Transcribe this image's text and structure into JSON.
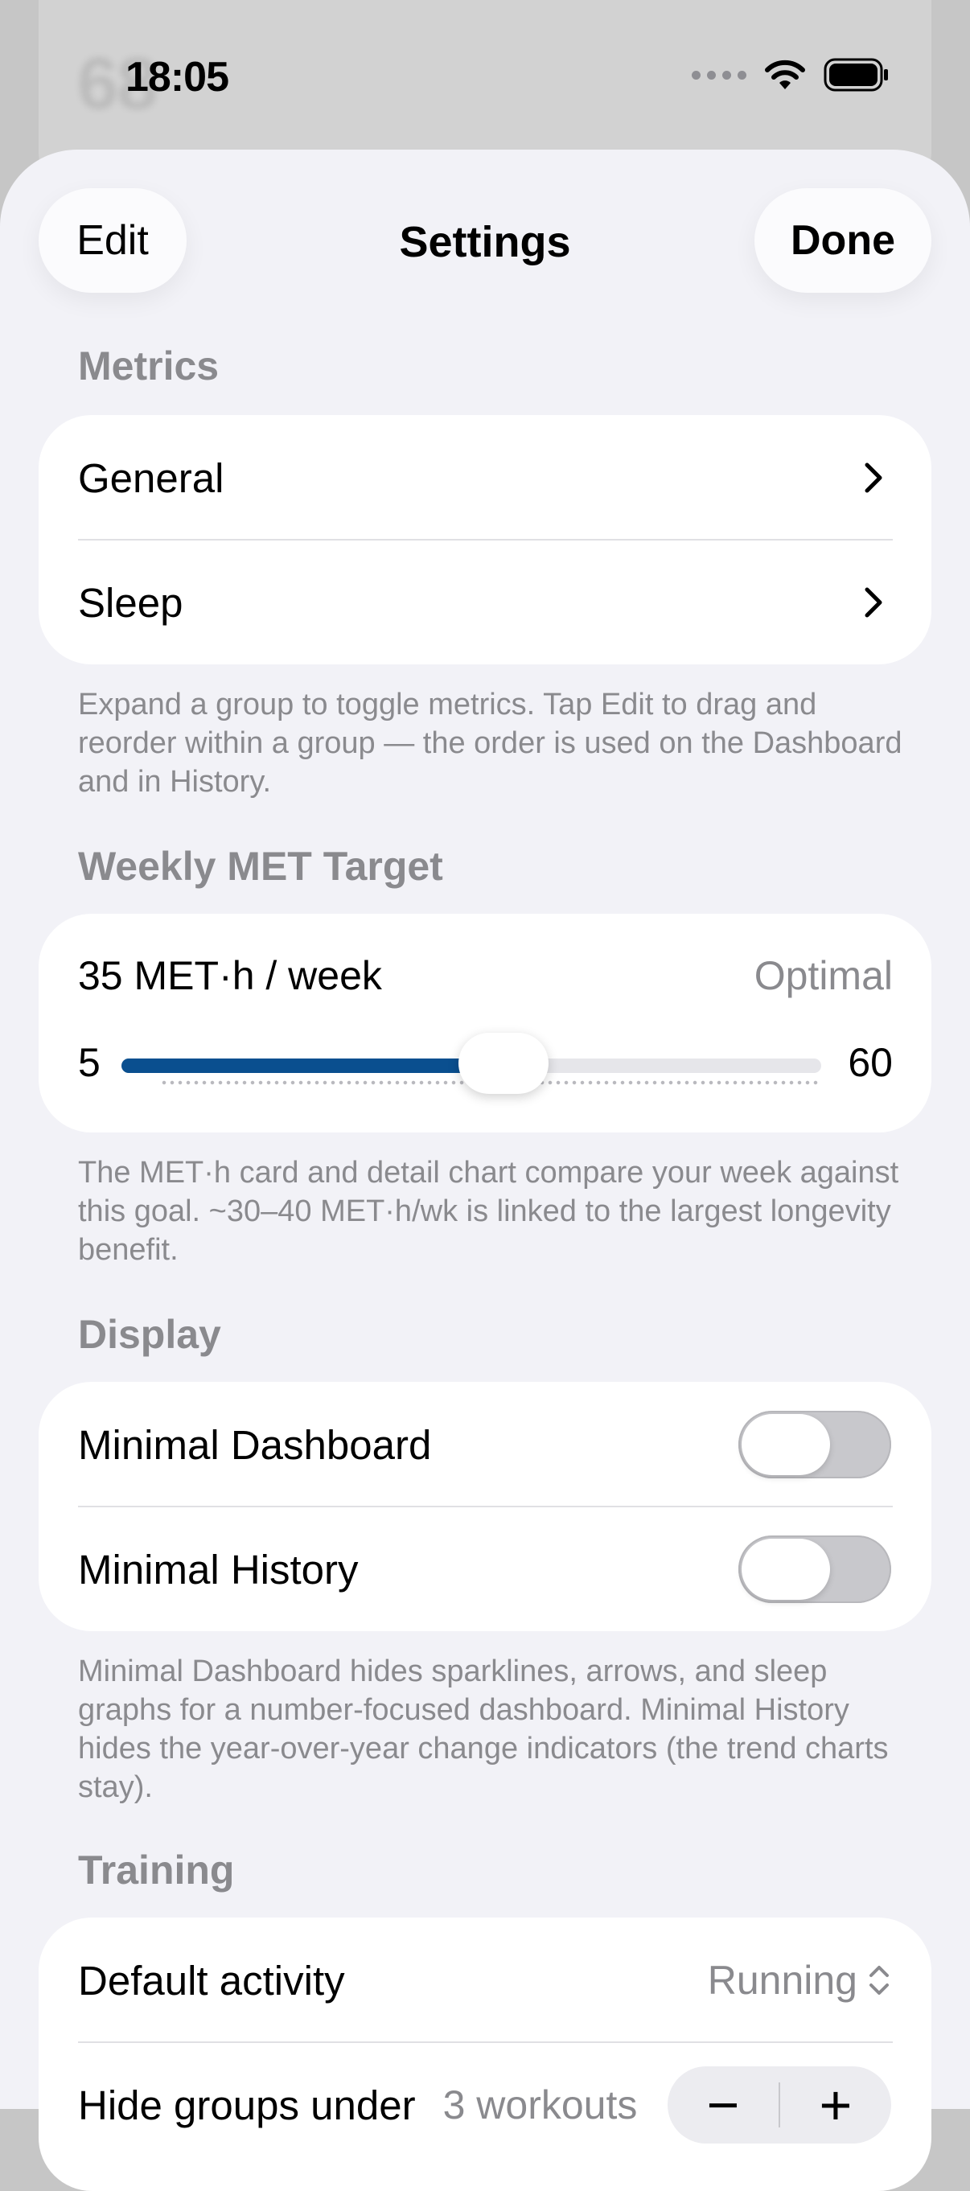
{
  "status_bar": {
    "time": "18:05"
  },
  "background": {
    "peek_number": "68"
  },
  "sheet": {
    "title": "Settings",
    "edit_label": "Edit",
    "done_label": "Done"
  },
  "metrics": {
    "header": "Metrics",
    "rows": [
      {
        "label": "General"
      },
      {
        "label": "Sleep"
      }
    ],
    "footer": "Expand a group to toggle metrics. Tap Edit to drag and reorder within a group — the order is used on the Dashboard and in History."
  },
  "met_target": {
    "header": "Weekly MET Target",
    "value_label": "35 MET·h / week",
    "status": "Optimal",
    "min_label": "5",
    "max_label": "60",
    "value": 35,
    "min": 5,
    "max": 60,
    "footer": "The MET·h card and detail chart compare your week against this goal. ~30–40 MET·h/wk is linked to the largest longevity benefit."
  },
  "display": {
    "header": "Display",
    "rows": [
      {
        "label": "Minimal Dashboard",
        "on": false
      },
      {
        "label": "Minimal History",
        "on": false
      }
    ],
    "footer": "Minimal Dashboard hides sparklines, arrows, and sleep graphs for a number-focused dashboard. Minimal History hides the year-over-year change indicators (the trend charts stay)."
  },
  "training": {
    "header": "Training",
    "default_activity_label": "Default activity",
    "default_activity_value": "Running",
    "hide_groups_label": "Hide groups under",
    "hide_groups_value": "3 workouts",
    "stepper_minus": "−",
    "stepper_plus": "+"
  },
  "colors": {
    "accent": "#0a4f8f",
    "background": "#f2f2f7",
    "secondary_text": "#8a8a8e"
  }
}
